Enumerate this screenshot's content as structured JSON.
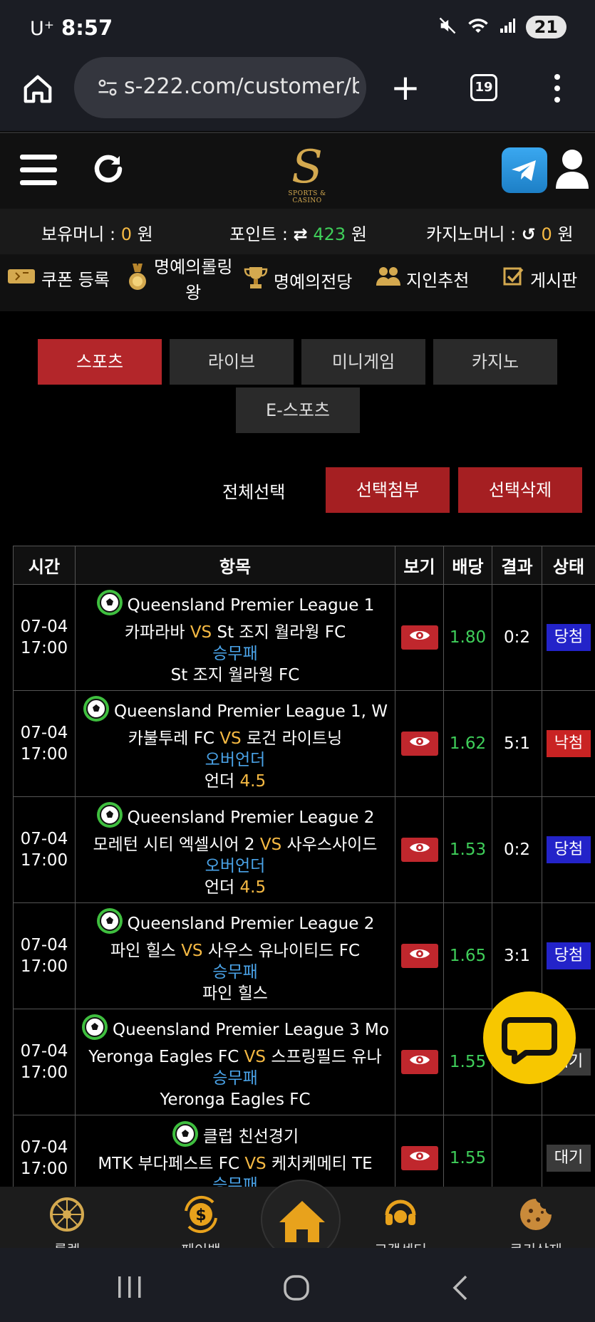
{
  "status_bar": {
    "carrier": "U⁺",
    "time": "8:57",
    "battery": "21"
  },
  "browser": {
    "url": "s-222.com/customer/b",
    "tab_count": "19"
  },
  "logo": {
    "letter": "S",
    "subtitle": "SPORTS & CASINO"
  },
  "money": {
    "holding_label": "보유머니 :",
    "holding_value": "0",
    "holding_unit": "원",
    "points_label": "포인트 :",
    "points_value": "423",
    "points_unit": "원",
    "casino_label": "카지노머니 :",
    "casino_value": "0",
    "casino_unit": "원"
  },
  "quick_menu": {
    "coupon": "쿠폰 등록",
    "roll_line1": "명예의롤링",
    "roll_line2": "왕",
    "fame": "명예의전당",
    "referral": "지인추천",
    "board": "게시판"
  },
  "tabs": [
    "스포츠",
    "라이브",
    "미니게임",
    "카지노",
    "E-스포츠"
  ],
  "actions": {
    "select_all": "전체선택",
    "attach": "선택첨부",
    "delete": "선택삭제"
  },
  "table": {
    "headers": [
      "시간",
      "항목",
      "보기",
      "배당",
      "결과",
      "상태"
    ],
    "rows": [
      {
        "date": "07-04",
        "time": "17:00",
        "league": "Queensland Premier League 1",
        "home": "카파라바",
        "vs": "VS",
        "away": "St 조지 월라웡 FC",
        "market": "승무패",
        "pick": "St 조지 월라웡 FC",
        "pick_extra": "",
        "odds": "1.80",
        "result": "0:2",
        "status": "당첨",
        "status_type": "win"
      },
      {
        "date": "07-04",
        "time": "17:00",
        "league": "Queensland Premier League 1, W",
        "home": "카불투레 FC",
        "vs": "VS",
        "away": "로건 라이트닝",
        "market": "오버언더",
        "pick": "언더",
        "pick_extra": "4.5",
        "odds": "1.62",
        "result": "5:1",
        "status": "낙첨",
        "status_type": "lose"
      },
      {
        "date": "07-04",
        "time": "17:00",
        "league": "Queensland Premier League 2",
        "home": "모레턴 시티 엑셀시어 2",
        "vs": "VS",
        "away": "사우스사이드",
        "market": "오버언더",
        "pick": "언더",
        "pick_extra": "4.5",
        "odds": "1.53",
        "result": "0:2",
        "status": "당첨",
        "status_type": "win"
      },
      {
        "date": "07-04",
        "time": "17:00",
        "league": "Queensland Premier League 2",
        "home": "파인 힐스",
        "vs": "VS",
        "away": "사우스 유나이티드 FC",
        "market": "승무패",
        "pick": "파인 힐스",
        "pick_extra": "",
        "odds": "1.65",
        "result": "3:1",
        "status": "당첨",
        "status_type": "win"
      },
      {
        "date": "07-04",
        "time": "17:00",
        "league": "Queensland Premier League 3 Mo",
        "home": "Yeronga Eagles FC",
        "vs": "VS",
        "away": "스프링필드 유나",
        "market": "승무패",
        "pick": "Yeronga Eagles FC",
        "pick_extra": "",
        "odds": "1.55",
        "result": "",
        "status": "대기",
        "status_type": "wait"
      },
      {
        "date": "07-04",
        "time": "17:00",
        "league": "클럽 친선경기",
        "home": "MTK 부다페스트 FC",
        "vs": "VS",
        "away": "케치케메티 TE",
        "market": "승무패",
        "pick": "",
        "pick_extra": "",
        "odds": "1.55",
        "result": "",
        "status": "대기",
        "status_type": "wait"
      }
    ]
  },
  "bottom_nav": {
    "roulette": "룰렛",
    "payback": "페이백",
    "support": "고객센터",
    "cookie": "쿠키삭제"
  },
  "colors": {
    "accent_red": "#b3262a",
    "win_blue": "#2323c9",
    "lose_red": "#c92323",
    "odds_green": "#3fcf5a",
    "gold": "#f5b943",
    "market_blue": "#4aa3e8"
  }
}
